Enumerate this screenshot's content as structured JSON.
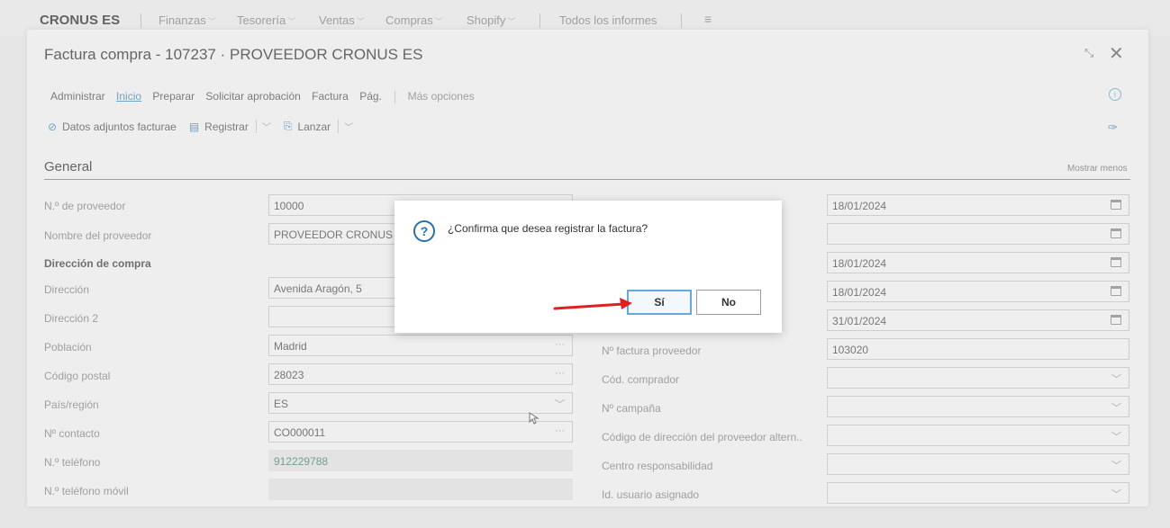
{
  "topnav": {
    "brand": "CRONUS ES",
    "items": [
      "Finanzas",
      "Tesorería",
      "Ventas",
      "Compras",
      "Shopify"
    ],
    "reports": "Todos los informes",
    "menu_icon": "hamburger-icon"
  },
  "page": {
    "title": "Factura compra - 107237 · PROVEEDOR CRONUS ES",
    "tabs": [
      "Administrar",
      "Inicio",
      "Preparar",
      "Solicitar aprobación",
      "Factura",
      "Pág."
    ],
    "more": "Más opciones",
    "toolbar": {
      "attachments": "Datos adjuntos facturae",
      "post": "Registrar",
      "release": "Lanzar"
    },
    "section_title": "General",
    "show_less": "Mostrar menos"
  },
  "left_fields": [
    {
      "label": "N.º de proveedor",
      "value": "10000"
    },
    {
      "label": "Nombre del proveedor",
      "value": "PROVEEDOR CRONUS ES"
    },
    {
      "label": "Dirección de compra",
      "value": ""
    },
    {
      "label": "Dirección",
      "value": "Avenida Aragón, 5"
    },
    {
      "label": "Dirección 2",
      "value": ""
    },
    {
      "label": "Población",
      "value": "Madrid"
    },
    {
      "label": "Código postal",
      "value": "28023"
    },
    {
      "label": "País/región",
      "value": "ES"
    },
    {
      "label": "Nº contacto",
      "value": "CO000011"
    },
    {
      "label": "N.º teléfono",
      "value": "912229788"
    },
    {
      "label": "N.º teléfono móvil",
      "value": ""
    }
  ],
  "right_fields": [
    {
      "label": "",
      "value": "18/01/2024"
    },
    {
      "label": "",
      "value": ""
    },
    {
      "label": "",
      "value": "18/01/2024"
    },
    {
      "label": "",
      "value": "18/01/2024"
    },
    {
      "label": "",
      "value": "31/01/2024"
    },
    {
      "label": "Nº factura proveedor",
      "value": "103020"
    },
    {
      "label": "Cód. comprador",
      "value": ""
    },
    {
      "label": "Nº campaña",
      "value": ""
    },
    {
      "label": "Código de dirección del proveedor altern..",
      "value": ""
    },
    {
      "label": "Centro responsabilidad",
      "value": ""
    },
    {
      "label": "Id. usuario asignado",
      "value": ""
    }
  ],
  "dialog": {
    "message": "¿Confirma que desea registrar la factura?",
    "yes": "Sí",
    "no": "No"
  },
  "colors": {
    "accent": "#2b6fa6",
    "arrow": "#e02020",
    "link": "#4a8fb7"
  }
}
